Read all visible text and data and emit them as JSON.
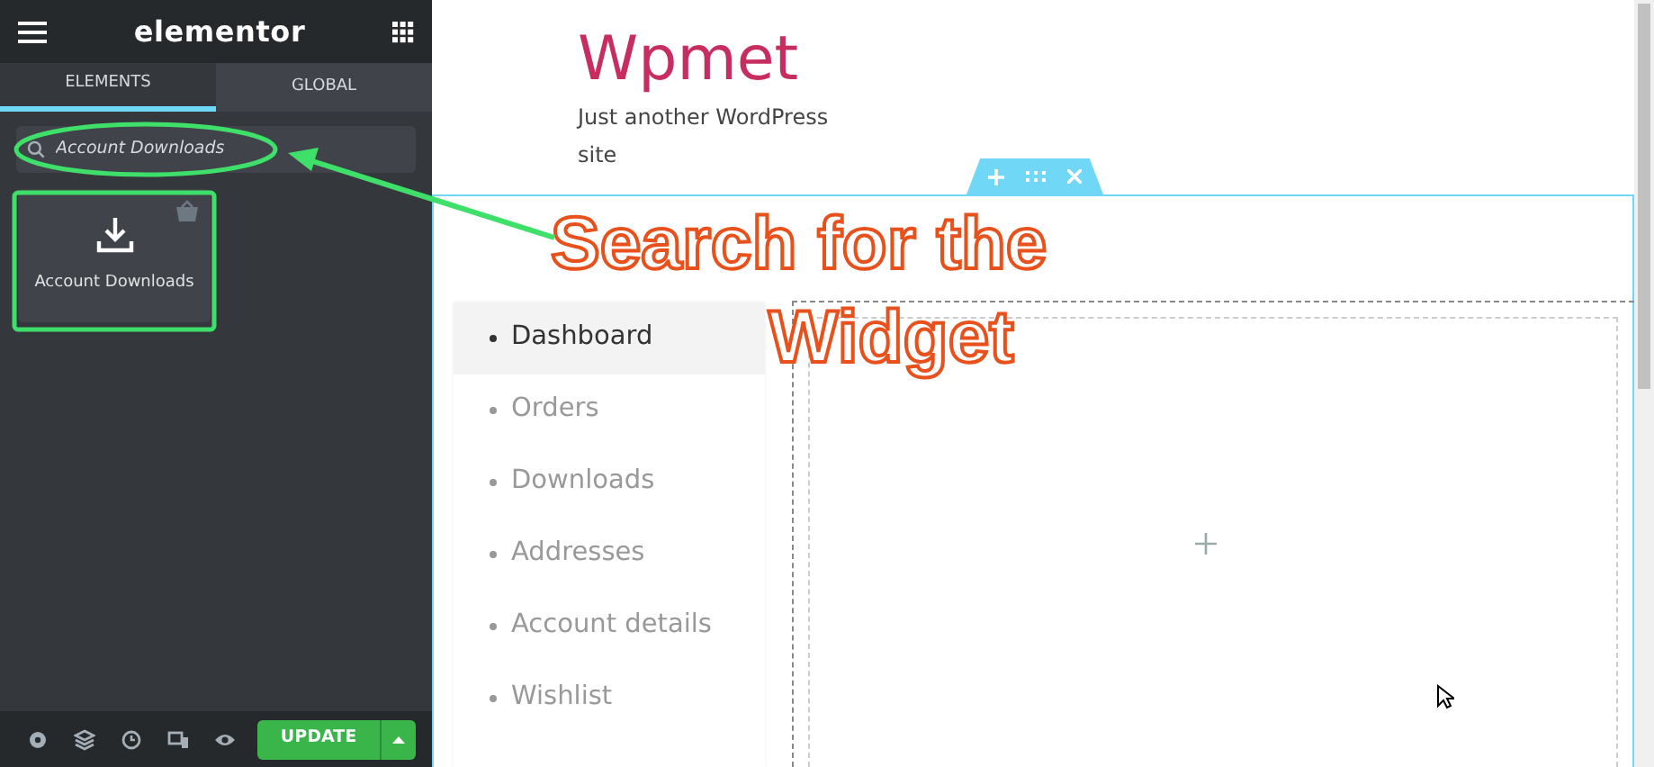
{
  "panel": {
    "logo": "elementor",
    "tabs": [
      {
        "label": "ELEMENTS",
        "selected": true
      },
      {
        "label": "GLOBAL",
        "selected": false
      }
    ],
    "search": {
      "value": "Account Downloads"
    },
    "widgets": [
      {
        "label": "Account Downloads",
        "pro": true
      }
    ],
    "footer": {
      "update_button": "UPDATE"
    }
  },
  "site": {
    "title": "Wpmet",
    "tagline": "Just another WordPress site"
  },
  "account_nav": [
    {
      "label": "Dashboard",
      "selected": true
    },
    {
      "label": "Orders",
      "selected": false
    },
    {
      "label": "Downloads",
      "selected": false
    },
    {
      "label": "Addresses",
      "selected": false
    },
    {
      "label": "Account details",
      "selected": false
    },
    {
      "label": "Wishlist",
      "selected": false
    }
  ],
  "annotation": {
    "lines": [
      "Search for the",
      "Widget"
    ]
  }
}
